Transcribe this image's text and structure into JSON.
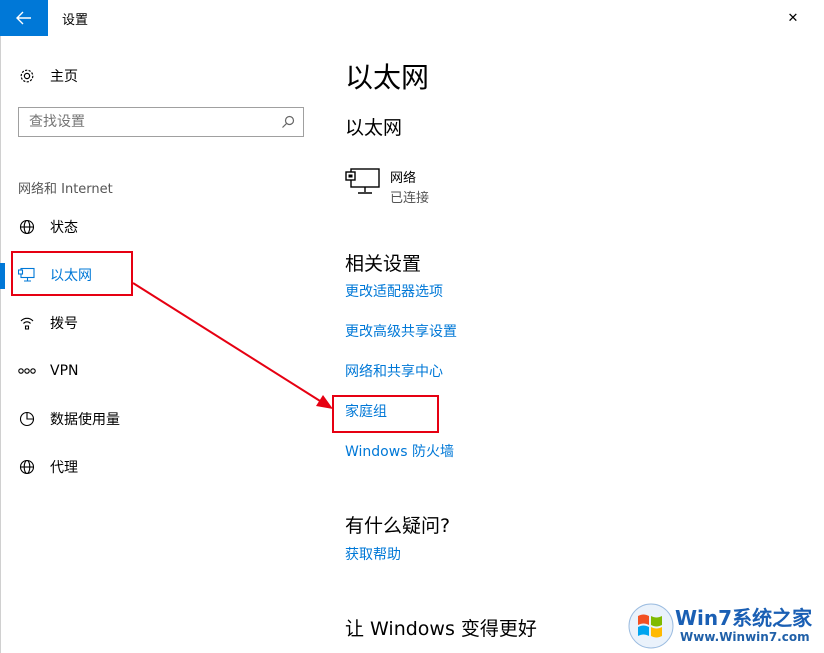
{
  "window": {
    "title": "设置",
    "back_icon": "arrow-left-icon",
    "close_glyph": "✕"
  },
  "sidebar": {
    "home_label": "主页",
    "search_placeholder": "查找设置",
    "section_label": "网络和 Internet",
    "items": [
      {
        "label": "状态",
        "icon": "globe-status-icon"
      },
      {
        "label": "以太网",
        "icon": "ethernet-icon",
        "active": true
      },
      {
        "label": "拨号",
        "icon": "dialup-icon"
      },
      {
        "label": "VPN",
        "icon": "vpn-icon"
      },
      {
        "label": "数据使用量",
        "icon": "data-usage-icon"
      },
      {
        "label": "代理",
        "icon": "globe-proxy-icon"
      }
    ]
  },
  "main": {
    "page_title": "以太网",
    "subtitle": "以太网",
    "network": {
      "name": "网络",
      "status": "已连接"
    },
    "related_heading": "相关设置",
    "related_links": [
      "更改适配器选项",
      "更改高级共享设置",
      "网络和共享中心",
      "家庭组",
      "Windows 防火墙"
    ],
    "question_heading": "有什么疑问?",
    "help_link": "获取帮助",
    "better_heading": "让 Windows 变得更好"
  },
  "colors": {
    "accent": "#0078d7",
    "annotation": "#e60012"
  },
  "watermark": {
    "brand": "Win7系统之家",
    "url": "Www.Winwin7.com"
  }
}
